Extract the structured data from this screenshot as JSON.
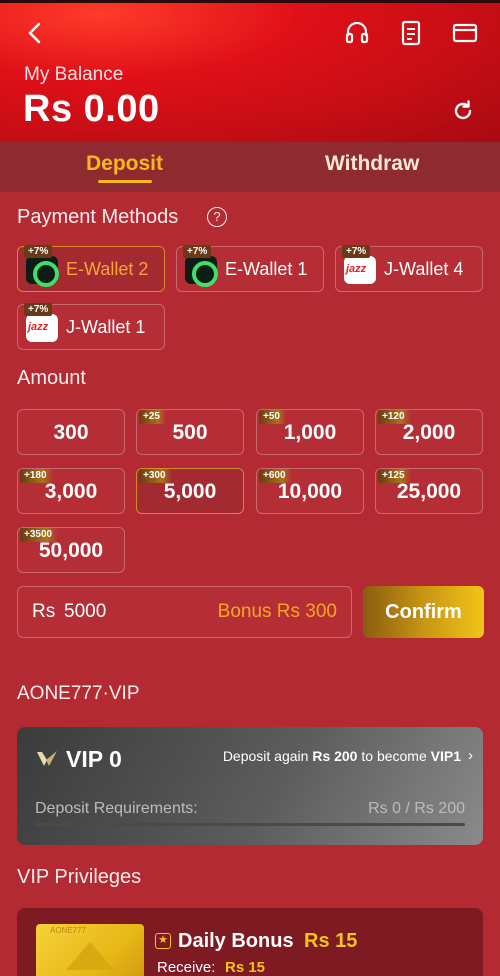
{
  "header": {
    "balance_label": "My Balance",
    "balance_value": "Rs 0.00",
    "icons": [
      "back-icon",
      "headset-icon",
      "document-icon",
      "wallet-card-icon",
      "refresh-icon"
    ]
  },
  "tabs": [
    {
      "label": "Deposit",
      "active": true
    },
    {
      "label": "Withdraw",
      "active": false
    }
  ],
  "payment": {
    "title": "Payment Methods",
    "help_glyph": "?",
    "methods": [
      {
        "label": "E-Wallet 2",
        "badge": "+7%",
        "logo": "ewallet-logo",
        "selected": true
      },
      {
        "label": "E-Wallet 1",
        "badge": "+7%",
        "logo": "ewallet-logo",
        "selected": false
      },
      {
        "label": "J-Wallet 4",
        "badge": "+7%",
        "logo": "jazz-logo",
        "selected": false
      },
      {
        "label": "J-Wallet 1",
        "badge": "+7%",
        "logo": "jazz-logo",
        "selected": false
      }
    ]
  },
  "amount": {
    "title": "Amount",
    "options": [
      {
        "value": "300",
        "bonus": ""
      },
      {
        "value": "500",
        "bonus": "+25"
      },
      {
        "value": "1,000",
        "bonus": "+50"
      },
      {
        "value": "2,000",
        "bonus": "+120"
      },
      {
        "value": "3,000",
        "bonus": "+180"
      },
      {
        "value": "5,000",
        "bonus": "+300"
      },
      {
        "value": "10,000",
        "bonus": "+600"
      },
      {
        "value": "25,000",
        "bonus": "+125"
      },
      {
        "value": "50,000",
        "bonus": "+3500"
      }
    ],
    "selected_index": 5,
    "input_currency": "Rs",
    "input_value": "5000",
    "bonus_text": "Bonus Rs 300",
    "confirm_label": "Confirm"
  },
  "vip": {
    "title": "AONE777·VIP",
    "level": "VIP 0",
    "next_prefix": "Deposit again ",
    "next_amount": "Rs 200",
    "next_middle": " to become ",
    "next_level": "VIP1",
    "chevron": "›",
    "req_label": "Deposit Requirements:",
    "req_value": "Rs 0 / Rs 200",
    "progress": 0
  },
  "privileges": {
    "title": "VIP Privileges",
    "thumb_text": "AONE777",
    "item_title": "Daily Bonus",
    "item_amount": "Rs 15",
    "receive_label": "Receive:",
    "receive_value": "Rs 15",
    "icon_glyph": "★"
  },
  "colors": {
    "accent_gold": "#f5b91e",
    "header_red": "#d9141c",
    "page_bg": "#b32a32",
    "bonus_orange": "#f5a623"
  }
}
